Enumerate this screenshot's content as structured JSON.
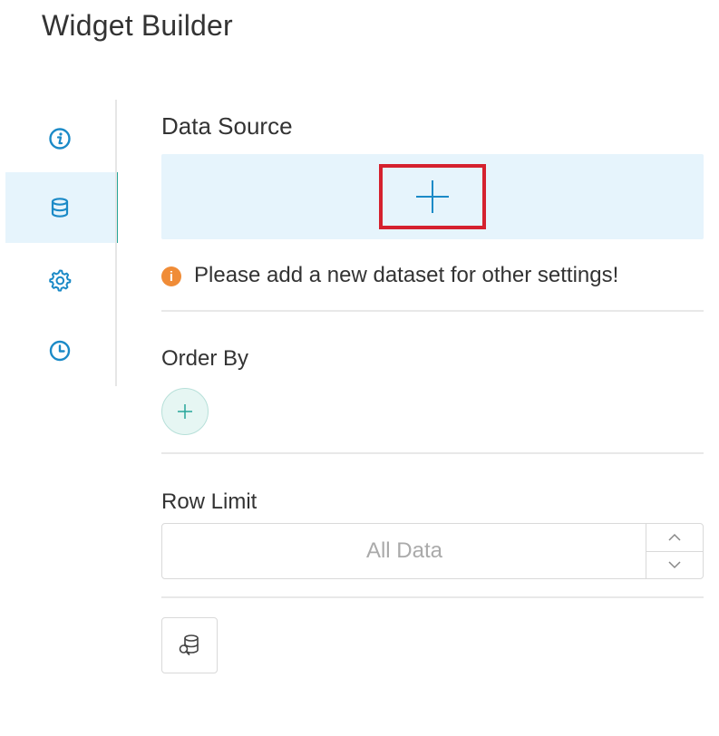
{
  "header": {
    "title": "Widget Builder"
  },
  "sidebar": {
    "items": [
      {
        "icon": "info-icon",
        "active": false
      },
      {
        "icon": "database-icon",
        "active": true
      },
      {
        "icon": "gear-icon",
        "active": false
      },
      {
        "icon": "clock-icon",
        "active": false
      }
    ],
    "accent_color": "#26a69a",
    "icon_color": "#1b8ac7"
  },
  "data_source": {
    "label": "Data Source",
    "add_icon": "plus-icon",
    "notice": "Please add a new dataset for other settings!",
    "notice_icon": "i"
  },
  "order_by": {
    "label": "Order By",
    "add_icon": "plus-icon"
  },
  "row_limit": {
    "label": "Row Limit",
    "placeholder": "All Data",
    "value": ""
  },
  "footer": {
    "query_icon": "database-search-icon"
  },
  "colors": {
    "highlight": "#d5212e",
    "panel_bg": "#e6f4fc",
    "notice": "#f08c37"
  }
}
